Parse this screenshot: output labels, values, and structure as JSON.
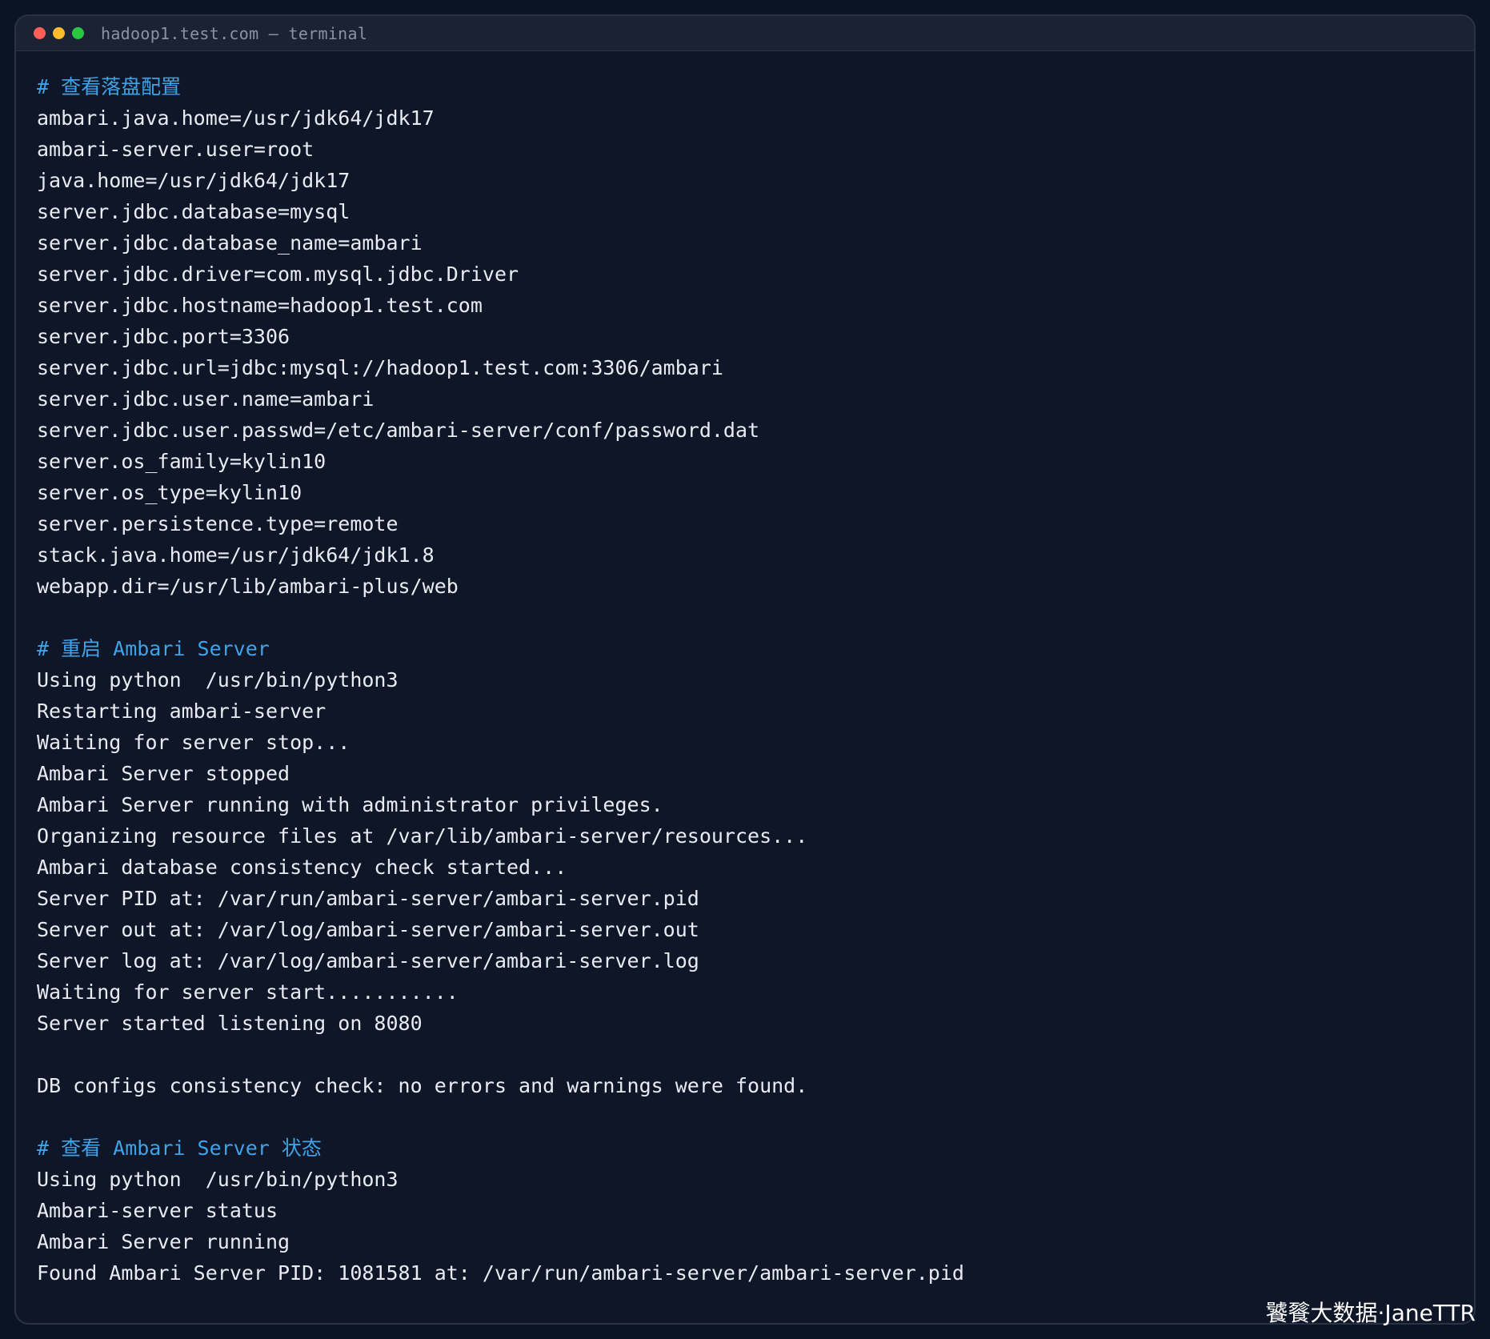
{
  "window": {
    "title": "hadoop1.test.com — terminal",
    "controls": [
      "close",
      "minimize",
      "maximize"
    ]
  },
  "colors": {
    "background": "#0e1628",
    "text": "#e8ebf1",
    "comment": "#3ea3e8",
    "close": "#ff5f57",
    "minimize": "#febc2e",
    "maximize": "#28c840"
  },
  "lines": [
    {
      "text": "# 查看落盘配置",
      "type": "comment"
    },
    {
      "text": "ambari.java.home=/usr/jdk64/jdk17",
      "type": "output"
    },
    {
      "text": "ambari-server.user=root",
      "type": "output"
    },
    {
      "text": "java.home=/usr/jdk64/jdk17",
      "type": "output"
    },
    {
      "text": "server.jdbc.database=mysql",
      "type": "output"
    },
    {
      "text": "server.jdbc.database_name=ambari",
      "type": "output"
    },
    {
      "text": "server.jdbc.driver=com.mysql.jdbc.Driver",
      "type": "output"
    },
    {
      "text": "server.jdbc.hostname=hadoop1.test.com",
      "type": "output"
    },
    {
      "text": "server.jdbc.port=3306",
      "type": "output"
    },
    {
      "text": "server.jdbc.url=jdbc:mysql://hadoop1.test.com:3306/ambari",
      "type": "output"
    },
    {
      "text": "server.jdbc.user.name=ambari",
      "type": "output"
    },
    {
      "text": "server.jdbc.user.passwd=/etc/ambari-server/conf/password.dat",
      "type": "output"
    },
    {
      "text": "server.os_family=kylin10",
      "type": "output"
    },
    {
      "text": "server.os_type=kylin10",
      "type": "output"
    },
    {
      "text": "server.persistence.type=remote",
      "type": "output"
    },
    {
      "text": "stack.java.home=/usr/jdk64/jdk1.8",
      "type": "output"
    },
    {
      "text": "webapp.dir=/usr/lib/ambari-plus/web",
      "type": "output"
    },
    {
      "text": "",
      "type": "blank"
    },
    {
      "text": "# 重启 Ambari Server",
      "type": "comment"
    },
    {
      "text": "Using python  /usr/bin/python3",
      "type": "output"
    },
    {
      "text": "Restarting ambari-server",
      "type": "output"
    },
    {
      "text": "Waiting for server stop...",
      "type": "output"
    },
    {
      "text": "Ambari Server stopped",
      "type": "output"
    },
    {
      "text": "Ambari Server running with administrator privileges.",
      "type": "output"
    },
    {
      "text": "Organizing resource files at /var/lib/ambari-server/resources...",
      "type": "output"
    },
    {
      "text": "Ambari database consistency check started...",
      "type": "output"
    },
    {
      "text": "Server PID at: /var/run/ambari-server/ambari-server.pid",
      "type": "output"
    },
    {
      "text": "Server out at: /var/log/ambari-server/ambari-server.out",
      "type": "output"
    },
    {
      "text": "Server log at: /var/log/ambari-server/ambari-server.log",
      "type": "output"
    },
    {
      "text": "Waiting for server start...........",
      "type": "output"
    },
    {
      "text": "Server started listening on 8080",
      "type": "output"
    },
    {
      "text": "",
      "type": "blank"
    },
    {
      "text": "DB configs consistency check: no errors and warnings were found.",
      "type": "output"
    },
    {
      "text": "",
      "type": "blank"
    },
    {
      "text": "# 查看 Ambari Server 状态",
      "type": "comment"
    },
    {
      "text": "Using python  /usr/bin/python3",
      "type": "output"
    },
    {
      "text": "Ambari-server status",
      "type": "output"
    },
    {
      "text": "Ambari Server running",
      "type": "output"
    },
    {
      "text": "Found Ambari Server PID: 1081581 at: /var/run/ambari-server/ambari-server.pid",
      "type": "output"
    }
  ],
  "watermark": "饕餮大数据·JaneTTR"
}
